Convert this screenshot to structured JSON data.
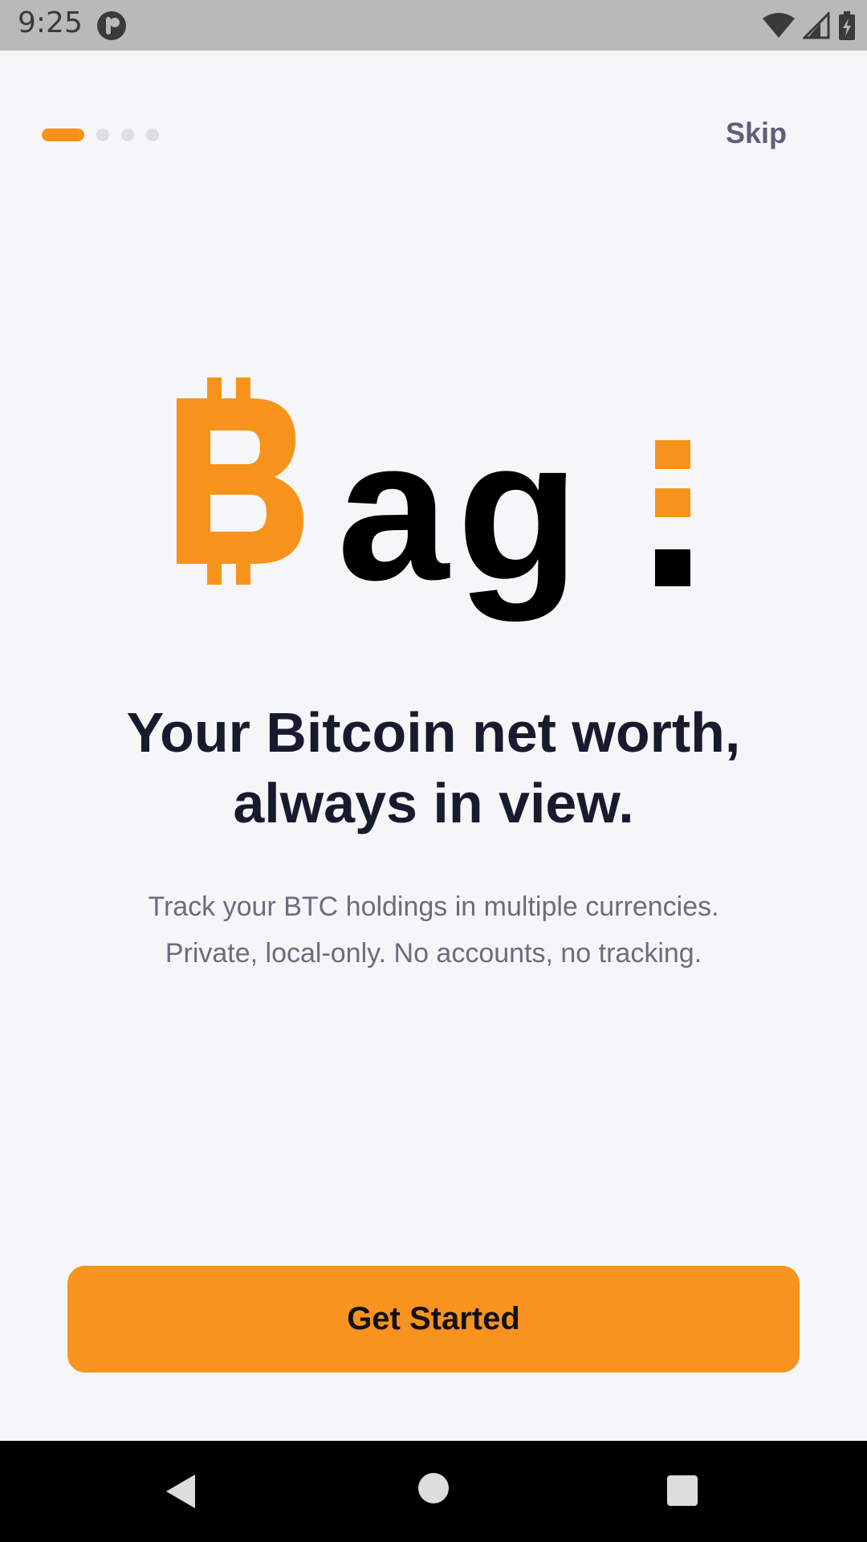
{
  "status_bar": {
    "time": "9:25",
    "icons": [
      "app-notification-icon",
      "wifi-icon",
      "signal-icon",
      "battery-charging-icon"
    ]
  },
  "onboarding": {
    "page_count": 4,
    "current_page": 1,
    "skip_label": "Skip",
    "logo_text": "ag",
    "headline": "Your Bitcoin net worth, always in view.",
    "subtitle_line1": "Track your BTC holdings in multiple currencies.",
    "subtitle_line2": "Private, local-only. No accounts, no tracking.",
    "cta_label": "Get Started"
  },
  "colors": {
    "accent": "#f7931a",
    "headline": "#181a2e",
    "muted": "#6a6c80",
    "background": "#f6f6f8"
  },
  "nav_bar": {
    "icons": [
      "back-icon",
      "home-icon",
      "recents-icon"
    ]
  }
}
